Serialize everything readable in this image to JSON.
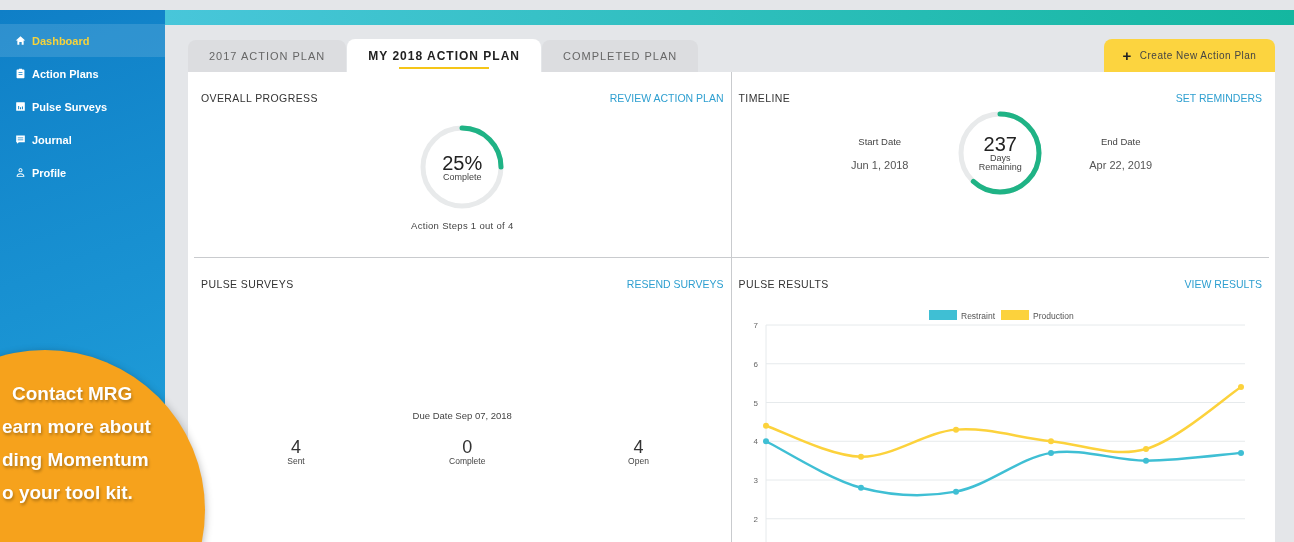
{
  "sidebar": {
    "items": [
      {
        "label": "Dashboard",
        "selected": true
      },
      {
        "label": "Action Plans",
        "selected": false
      },
      {
        "label": "Pulse Surveys",
        "selected": false
      },
      {
        "label": "Journal",
        "selected": false
      },
      {
        "label": "Profile",
        "selected": false
      }
    ]
  },
  "tabs": [
    {
      "label": "2017 ACTION PLAN",
      "selected": false
    },
    {
      "label": "MY 2018 ACTION PLAN",
      "selected": true
    },
    {
      "label": "COMPLETED PLAN",
      "selected": false
    }
  ],
  "create_button": {
    "icon": "+",
    "label": "Create New Action Plan"
  },
  "overall_progress": {
    "title": "OVERALL PROGRESS",
    "link": "REVIEW ACTION PLAN",
    "value": "25%",
    "caption": "Complete",
    "level": 0.25,
    "steps": "Action Steps 1 out of 4"
  },
  "timeline": {
    "title": "TIMELINE",
    "link": "SET REMINDERS",
    "start_label": "Start Date",
    "start_date": "Jun 1, 2018",
    "value": "237",
    "caption_1": "Days",
    "caption_2": "Remaining",
    "level": 0.62,
    "end_label": "End Date",
    "end_date": "Apr 22, 2019"
  },
  "pulse_surveys": {
    "title": "PULSE SURVEYS",
    "link": "RESEND SURVEYS",
    "due": "Due Date Sep 07, 2018",
    "stats": [
      {
        "value": "4",
        "label": "Sent"
      },
      {
        "value": "0",
        "label": "Complete"
      },
      {
        "value": "4",
        "label": "Open"
      }
    ]
  },
  "pulse_results": {
    "title": "PULSE RESULTS",
    "link": "VIEW RESULTS",
    "chart_data": {
      "type": "line",
      "grid": true,
      "legend": true,
      "ylim": [
        1.4,
        7
      ],
      "yticks": [
        2,
        3,
        4,
        5,
        6,
        7
      ],
      "series": [
        {
          "name": "Restraint",
          "color": "#3fbfd4",
          "marker": "circle",
          "values": [
            4,
            2.8,
            2.7,
            3.7,
            3.5,
            3.7
          ]
        },
        {
          "name": "Production",
          "color": "#fcd23c",
          "marker": "circle",
          "values": [
            4.4,
            3.6,
            4.3,
            4.0,
            3.8,
            5.4
          ]
        }
      ]
    }
  },
  "promo": {
    "lines": [
      "Contact MRG",
      "earn more about",
      "ding Momentum",
      "o your tool kit."
    ]
  }
}
